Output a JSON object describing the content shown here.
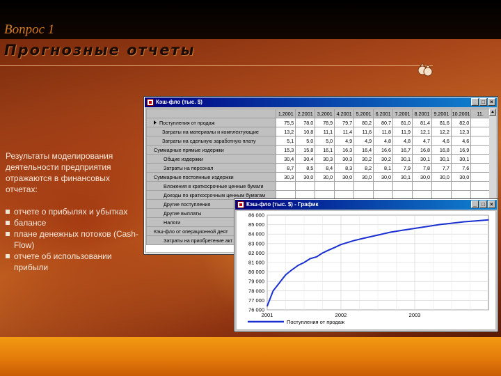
{
  "slide": {
    "question": "Вопрос 1",
    "title": "Прогнозные отчеты",
    "intro": "Результаты моделирования деятельности предприятия отражаются в финансовых отчетах:",
    "bullets": [
      "отчете о прибылях и убытках",
      "балансе",
      "плане денежных потоков (Cash-Flow)",
      "отчете об использовании прибыли"
    ],
    "deco_icon": "money-bags-icon"
  },
  "table_window": {
    "title": "Кэш-фло (тыс. $)",
    "buttons": [
      "_",
      "□",
      "×"
    ],
    "columns": [
      "1.2001",
      "2.2001",
      "3.2001",
      "4.2001",
      "5.2001",
      "6.2001",
      "7.2001",
      "8.2001",
      "9.2001",
      "10.2001",
      "11."
    ],
    "rows": [
      {
        "label": "Поступления от продаж",
        "level": 0,
        "values": [
          "75,5",
          "78,0",
          "78,9",
          "79,7",
          "80,2",
          "80,7",
          "81,0",
          "81,4",
          "81,6",
          "82,0",
          ""
        ]
      },
      {
        "label": "Затраты на материалы и комплектующие",
        "level": 1,
        "values": [
          "13,2",
          "10,8",
          "11,1",
          "11,4",
          "11,6",
          "11,8",
          "11,9",
          "12,1",
          "12,2",
          "12,3",
          ""
        ]
      },
      {
        "label": "Затраты на сдельную заработную плату",
        "level": 1,
        "values": [
          "5,1",
          "5,0",
          "5,0",
          "4,9",
          "4,9",
          "4,8",
          "4,8",
          "4,7",
          "4,6",
          "4,6",
          ""
        ]
      },
      {
        "label": "Суммарные прямые издержки",
        "level": 0,
        "values": [
          "15,3",
          "15,8",
          "16,1",
          "16,3",
          "16,4",
          "16,6",
          "16,7",
          "16,8",
          "16,8",
          "16,9",
          ""
        ]
      },
      {
        "label": "Общие издержки",
        "level": 2,
        "values": [
          "30,4",
          "30,4",
          "30,3",
          "30,3",
          "30,2",
          "30,2",
          "30,1",
          "30,1",
          "30,1",
          "30,1",
          ""
        ]
      },
      {
        "label": "Затраты на персонал",
        "level": 2,
        "values": [
          "8,7",
          "8,5",
          "8,4",
          "8,3",
          "8,2",
          "8,1",
          "7,9",
          "7,8",
          "7,7",
          "7,6",
          ""
        ]
      },
      {
        "label": "Суммарные постоянные издержки",
        "level": 0,
        "values": [
          "30,3",
          "30,0",
          "30,0",
          "30,0",
          "30,0",
          "30,0",
          "30,1",
          "30,0",
          "30,0",
          "30,0",
          ""
        ]
      },
      {
        "label": "Вложения в краткосрочные ценные бумаги",
        "level": 2,
        "values": [
          "",
          "",
          "",
          "",
          "",
          "",
          "",
          "",
          "",
          "",
          ""
        ]
      },
      {
        "label": "Доходы по краткосрочным ценным бумагам",
        "level": 2,
        "values": [
          "",
          "",
          "",
          "",
          "",
          "",
          "",
          "",
          "",
          "",
          ""
        ]
      },
      {
        "label": "Другие поступления",
        "level": 2,
        "values": [
          "",
          "",
          "",
          "",
          "",
          "",
          "",
          "",
          "",
          "",
          ""
        ]
      },
      {
        "label": "Другие выплаты",
        "level": 2,
        "values": [
          "",
          "",
          "",
          "",
          "",
          "",
          "",
          "",
          "",
          "",
          ""
        ]
      },
      {
        "label": "Налоги",
        "level": 2,
        "values": [
          "",
          "",
          "",
          "",
          "",
          "",
          "",
          "",
          "",
          "",
          ""
        ]
      },
      {
        "label": "Кэш-фло от операционной деят",
        "level": 0,
        "values": [
          "",
          "",
          "",
          "",
          "",
          "",
          "",
          "",
          "",
          "",
          ""
        ]
      },
      {
        "label": "Затраты на приобретение акт",
        "level": 2,
        "values": [
          "",
          "",
          "",
          "",
          "",
          "",
          "",
          "",
          "",
          "",
          ""
        ]
      }
    ]
  },
  "graph_window": {
    "title": "Кэш-фло (тыс. $) - График",
    "buttons": [
      "_",
      "□",
      "×"
    ]
  },
  "chart_data": {
    "type": "line",
    "title": "",
    "xlabel": "",
    "ylabel": "",
    "x_ticks": [
      "2001",
      "2002",
      "2003"
    ],
    "y_ticks": [
      "76 000",
      "77 000",
      "78 000",
      "79 000",
      "80 000",
      "81 000",
      "82 000",
      "83 000",
      "84 000",
      "85 000",
      "86 000"
    ],
    "ylim": [
      76000,
      86000
    ],
    "xlim": [
      2001.0,
      2004.0
    ],
    "grid": true,
    "legend_position": "bottom-left",
    "series": [
      {
        "name": "Поступления от продаж",
        "color": "#1a2fd0",
        "points": [
          [
            2001.0,
            76400
          ],
          [
            2001.08,
            78000
          ],
          [
            2001.17,
            78900
          ],
          [
            2001.25,
            79700
          ],
          [
            2001.33,
            80200
          ],
          [
            2001.42,
            80700
          ],
          [
            2001.5,
            81000
          ],
          [
            2001.58,
            81400
          ],
          [
            2001.67,
            81600
          ],
          [
            2001.75,
            82000
          ],
          [
            2001.83,
            82300
          ],
          [
            2001.92,
            82600
          ],
          [
            2002.0,
            82900
          ],
          [
            2002.17,
            83300
          ],
          [
            2002.33,
            83600
          ],
          [
            2002.5,
            83900
          ],
          [
            2002.67,
            84200
          ],
          [
            2002.83,
            84400
          ],
          [
            2003.0,
            84600
          ],
          [
            2003.17,
            84800
          ],
          [
            2003.33,
            85000
          ],
          [
            2003.5,
            85150
          ],
          [
            2003.67,
            85300
          ],
          [
            2003.83,
            85400
          ],
          [
            2004.0,
            85500
          ]
        ]
      }
    ]
  }
}
